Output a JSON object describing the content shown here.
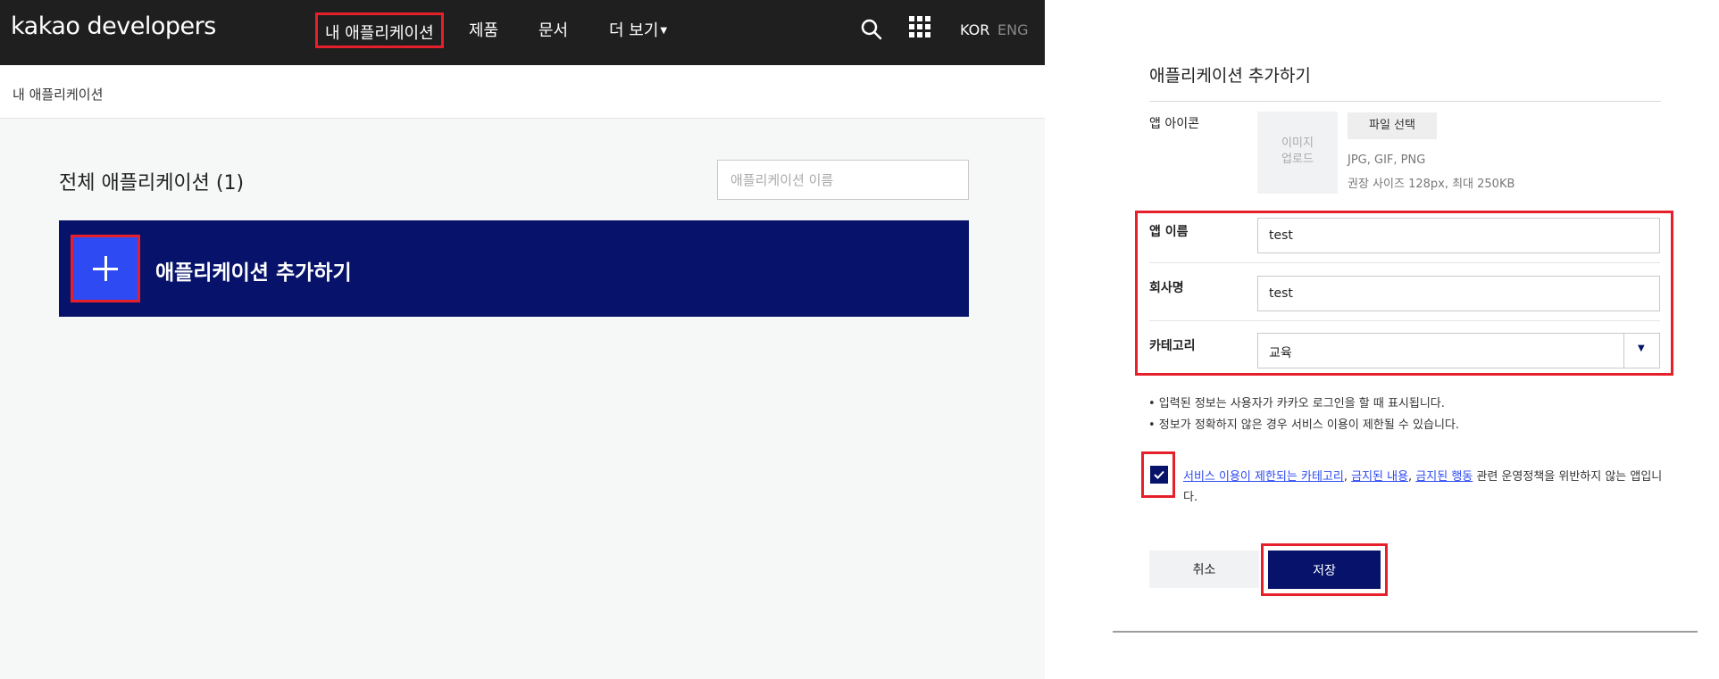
{
  "header": {
    "logo": "kakao developers",
    "nav": [
      "내 애플리케이션",
      "제품",
      "문서",
      "더 보기"
    ],
    "lang_kor": "KOR",
    "lang_eng": "ENG"
  },
  "breadcrumb": "내 애플리케이션",
  "apps": {
    "title": "전체 애플리케이션 (1)",
    "search_placeholder": "애플리케이션 이름",
    "add_label": "애플리케이션 추가하기"
  },
  "form": {
    "title": "애플리케이션 추가하기",
    "icon_label": "앱 아이콘",
    "upload_line1": "이미지",
    "upload_line2": "업로드",
    "file_button": "파일 선택",
    "file_formats": "JPG, GIF, PNG",
    "file_size": "권장 사이즈 128px, 최대 250KB",
    "app_name_label": "앱 이름",
    "app_name_value": "test",
    "company_label": "회사명",
    "company_value": "test",
    "category_label": "카테고리",
    "category_value": "교육",
    "notes": [
      "• 입력된 정보는 사용자가 카카오 로그인을 할 때 표시됩니다.",
      "• 정보가 정확하지 않은 경우 서비스 이용이 제한될 수 있습니다."
    ],
    "consent_link1": "서비스 이용이 제한되는 카테고리",
    "consent_link2": "금지된 내용",
    "consent_link3": "금지된 행동",
    "consent_sep": ", ",
    "consent_rest": " 관련 운영정책을 위반하지 않는 앱입니다.",
    "cancel_label": "취소",
    "save_label": "저장"
  },
  "colors": {
    "topbar": "#1f1f1f",
    "navy": "#07136a",
    "plus_blue": "#2d4af3",
    "highlight_red": "#e5202a"
  }
}
